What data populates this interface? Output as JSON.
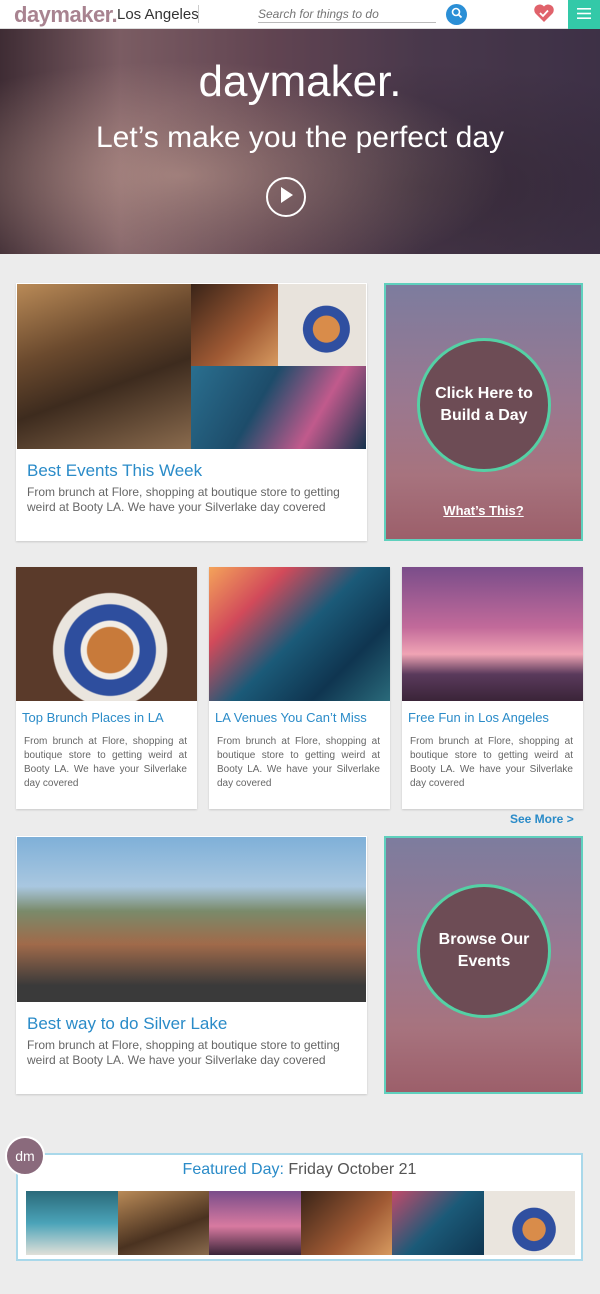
{
  "header": {
    "logo": "daymaker.",
    "city": "Los Angeles",
    "search_placeholder": "Search for things to do",
    "icons": {
      "search": "search-icon",
      "favorites": "heart-icon",
      "menu": "hamburger-icon"
    }
  },
  "hero": {
    "title": "daymaker.",
    "subtitle": "Let’s make you the perfect day"
  },
  "cards": {
    "best_events": {
      "title": "Best Events This Week",
      "desc": "From brunch at Flore, shopping at boutique store to getting weird at Booty LA. We have your Silverlake day covered"
    },
    "build_day": {
      "label": "Click Here to Build a Day",
      "link": "What’s This?"
    },
    "brunch": {
      "title": "Top Brunch Places in LA",
      "desc": "From brunch at Flore, shopping at boutique store to getting weird at Booty LA. We have your Silverlake day covered"
    },
    "venues": {
      "title": "LA Venues You Can’t Miss",
      "desc": "From brunch at Flore, shopping at boutique store to getting weird at Booty LA. We have your Silverlake day covered"
    },
    "free_fun": {
      "title": "Free Fun in Los Angeles",
      "desc": "From brunch at Flore, shopping at boutique store to getting weird at Booty LA. We have your Silverlake day covered"
    },
    "see_more": "See More >",
    "silver_lake": {
      "title": "Best way to do Silver Lake",
      "desc": "From brunch at Flore, shopping at boutique store to getting weird at Booty LA. We have your Silverlake day covered"
    },
    "browse": {
      "label": "Browse Our Events"
    }
  },
  "featured": {
    "badge": "dm",
    "label": "Featured Day:",
    "date": "Friday October 21"
  },
  "colors": {
    "accent_blue": "#2a8bc8",
    "accent_teal": "#33c9a8",
    "brand_mauve": "#a88390"
  }
}
